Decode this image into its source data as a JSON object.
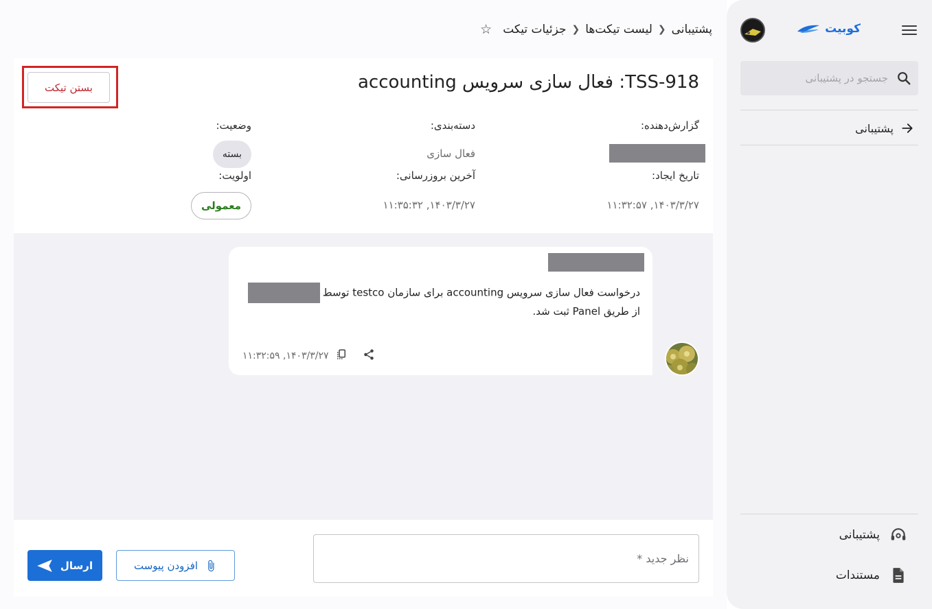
{
  "sidebar": {
    "brand_name": "کوبیت",
    "search_placeholder": "جستجو در پشتیبانی",
    "back_label": "پشتیبانی",
    "bottom_items": [
      {
        "label": "پشتیبانی",
        "icon": "headset-icon"
      },
      {
        "label": "مستندات",
        "icon": "document-icon"
      }
    ]
  },
  "breadcrumb": {
    "items": [
      "پشتیبانی",
      "لیست تیکت‌ها",
      "جزئیات تیکت"
    ]
  },
  "ticket": {
    "title": "TSS-918: فعال سازی سرویس accounting",
    "close_button": "بستن تیکت",
    "fields": {
      "reporter_label": "گزارش‌دهنده:",
      "category_label": "دسته‌بندی:",
      "category_value": "فعال سازی",
      "status_label": "وضعیت:",
      "status_value": "بسته",
      "created_label": "تاریخ ایجاد:",
      "created_value": "۱۴۰۳/۳/۲۷, ۱۱:۳۲:۵۷",
      "updated_label": "آخرین بروزرسانی:",
      "updated_value": "۱۴۰۳/۳/۲۷, ۱۱:۳۵:۳۲",
      "priority_label": "اولویت:",
      "priority_value": "معمولی"
    }
  },
  "message": {
    "text_part1": "درخواست فعال سازی سرویس accounting برای سازمان testco توسط",
    "text_part2": "از طریق Panel ثبت شد.",
    "timestamp": "۱۴۰۳/۳/۲۷, ۱۱:۳۲:۵۹"
  },
  "composer": {
    "placeholder": "نظر جدید *",
    "attach_label": "افزودن پیوست",
    "send_label": "ارسال"
  },
  "colors": {
    "primary": "#1c6fd6",
    "danger": "#c0272d",
    "priority_green": "#2a7d1f"
  }
}
